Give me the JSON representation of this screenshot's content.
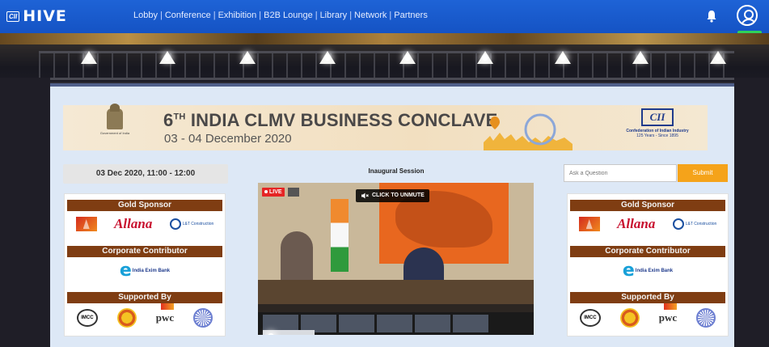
{
  "app": {
    "logo_badge": "CII",
    "logo_text": "HIVE"
  },
  "nav": {
    "items": [
      "Lobby",
      "Conference",
      "Exhibition",
      "B2B Lounge",
      "Library",
      "Network",
      "Partners"
    ]
  },
  "banner": {
    "title_num": "6",
    "title_sup": "TH",
    "title_rest": " INDIA CLMV  BUSINESS CONCLAVE",
    "dates": "03 - 04 December 2020",
    "emblem_text": "Government of India",
    "cii_logo": "CII",
    "cii_org": "Confederation of Indian Industry",
    "cii_tagline": "125 Years - Since 1895"
  },
  "session": {
    "datetime": "03 Dec 2020, 11:00 - 12:00",
    "title": "Inaugural Session"
  },
  "question": {
    "placeholder": "Ask a Question",
    "submit_label": "Submit"
  },
  "video": {
    "live_label": "LIVE",
    "unmute_label": "CLICK TO UNMUTE"
  },
  "sponsors": {
    "gold_title": "Gold Sponsor",
    "contributor_title": "Corporate Contributor",
    "supported_title": "Supported By",
    "allana": "Allana",
    "lt_text": "L&T Construction",
    "ebank_text": "India Exim Bank",
    "imcc": "IMCC",
    "pwc": "pwc"
  },
  "colors": {
    "topbar": "#1553c4",
    "sponsor_bar": "#7f3d12",
    "submit": "#f5a31a",
    "live": "#e52525"
  }
}
